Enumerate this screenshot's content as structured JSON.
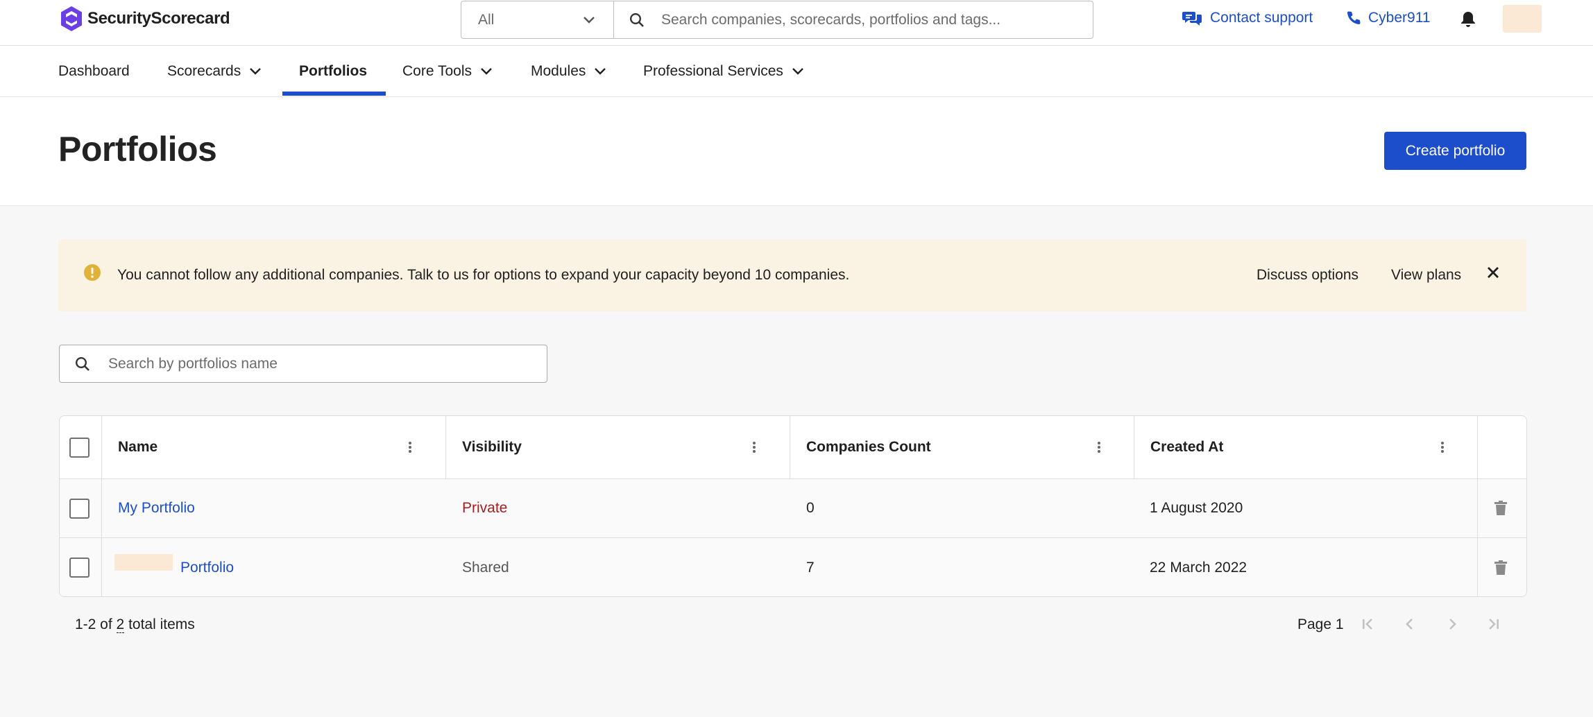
{
  "brand": {
    "name": "SecurityScorecard",
    "accent": "#1c4ecb",
    "logo_color": "#6b3fe6"
  },
  "topbar": {
    "search_scope": "All",
    "search_placeholder": "Search companies, scorecards, portfolios and tags...",
    "contact_support": "Contact support",
    "cyber911": "Cyber911",
    "icons": {
      "contact": "chat-bubbles-icon",
      "cyber": "phone-icon",
      "notifications": "bell-icon"
    }
  },
  "nav": {
    "items": [
      {
        "label": "Dashboard",
        "dropdown": false,
        "active": false
      },
      {
        "label": "Scorecards",
        "dropdown": true,
        "active": false
      },
      {
        "label": "Portfolios",
        "dropdown": false,
        "active": true
      },
      {
        "label": "Core Tools",
        "dropdown": true,
        "active": false
      },
      {
        "label": "Modules",
        "dropdown": true,
        "active": false
      },
      {
        "label": "Professional Services",
        "dropdown": true,
        "active": false
      }
    ]
  },
  "header": {
    "title": "Portfolios",
    "create_button": "Create portfolio"
  },
  "banner": {
    "message": "You cannot follow any additional companies. Talk to us for options to expand your capacity beyond 10 companies.",
    "discuss": "Discuss options",
    "view_plans": "View plans",
    "icon": "warning-circle-icon",
    "warning_color": "#e0b23a"
  },
  "portfolio_search": {
    "placeholder": "Search by portfolios name"
  },
  "table": {
    "columns": [
      "Name",
      "Visibility",
      "Companies Count",
      "Created At"
    ],
    "rows": [
      {
        "name": "My Portfolio",
        "visibility": "Private",
        "count": "0",
        "created": "1 August 2020"
      },
      {
        "name": "Portfolio",
        "visibility": "Shared",
        "count": "7",
        "created": "22 March 2022"
      }
    ]
  },
  "pagination": {
    "range": "1-2 of",
    "total": "2",
    "suffix": "total items",
    "page": "Page 1"
  }
}
